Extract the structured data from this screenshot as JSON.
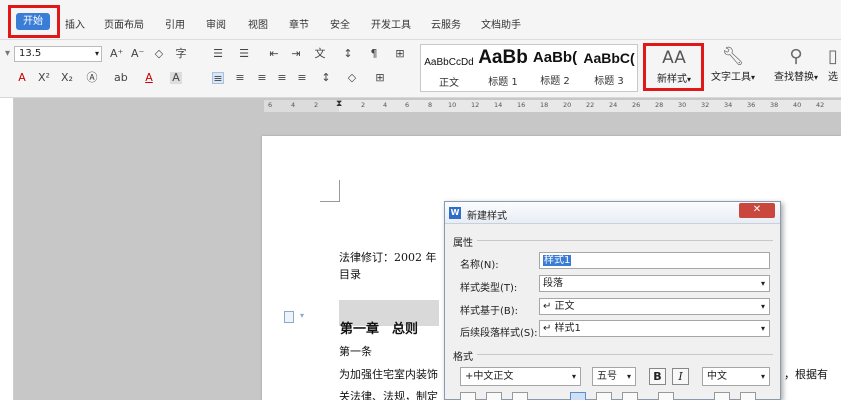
{
  "menu": {
    "items": [
      "开始",
      "插入",
      "页面布局",
      "引用",
      "审阅",
      "视图",
      "章节",
      "安全",
      "开发工具",
      "云服务",
      "文档助手"
    ]
  },
  "ribbon": {
    "font_size": "13.5",
    "style_gallery": [
      {
        "sample": "AaBbCcDd",
        "label": "正文"
      },
      {
        "sample": "AaBb",
        "label": "标题 1"
      },
      {
        "sample": "AaBb(",
        "label": "标题 2"
      },
      {
        "sample": "AaBbC(",
        "label": "标题 3"
      }
    ],
    "new_style_label": "新样式",
    "text_tools_label": "文字工具",
    "find_replace_label": "查找替换",
    "extra_label": "选"
  },
  "ruler": {
    "ticks": [
      "6",
      "4",
      "2",
      "2",
      "4",
      "6",
      "8",
      "10",
      "12",
      "14",
      "16",
      "18",
      "20",
      "22",
      "24",
      "26",
      "28",
      "30",
      "32",
      "34",
      "36",
      "38",
      "40",
      "42"
    ]
  },
  "document": {
    "law_line": "法律修订：2002 年",
    "toc": "目录",
    "chapter": "第一章　总则",
    "article": "第一条",
    "para1": "为加强住宅室内装饰",
    "para1_right": "，根据有",
    "para2": "关法律、法规，制定"
  },
  "dialog": {
    "title": "新建样式",
    "close": "✕",
    "properties_label": "属性",
    "name_label": "名称(N):",
    "name_value": "样式1",
    "type_label": "样式类型(T):",
    "type_value": "段落",
    "based_on_label": "样式基于(B):",
    "based_on_value": "↵ 正文",
    "following_label": "后续段落样式(S):",
    "following_value": "↵ 样式1",
    "format_label": "格式",
    "font_value": "+中文正文",
    "size_value": "五号",
    "bold": "B",
    "italic": "I",
    "lang_value": "中文"
  }
}
